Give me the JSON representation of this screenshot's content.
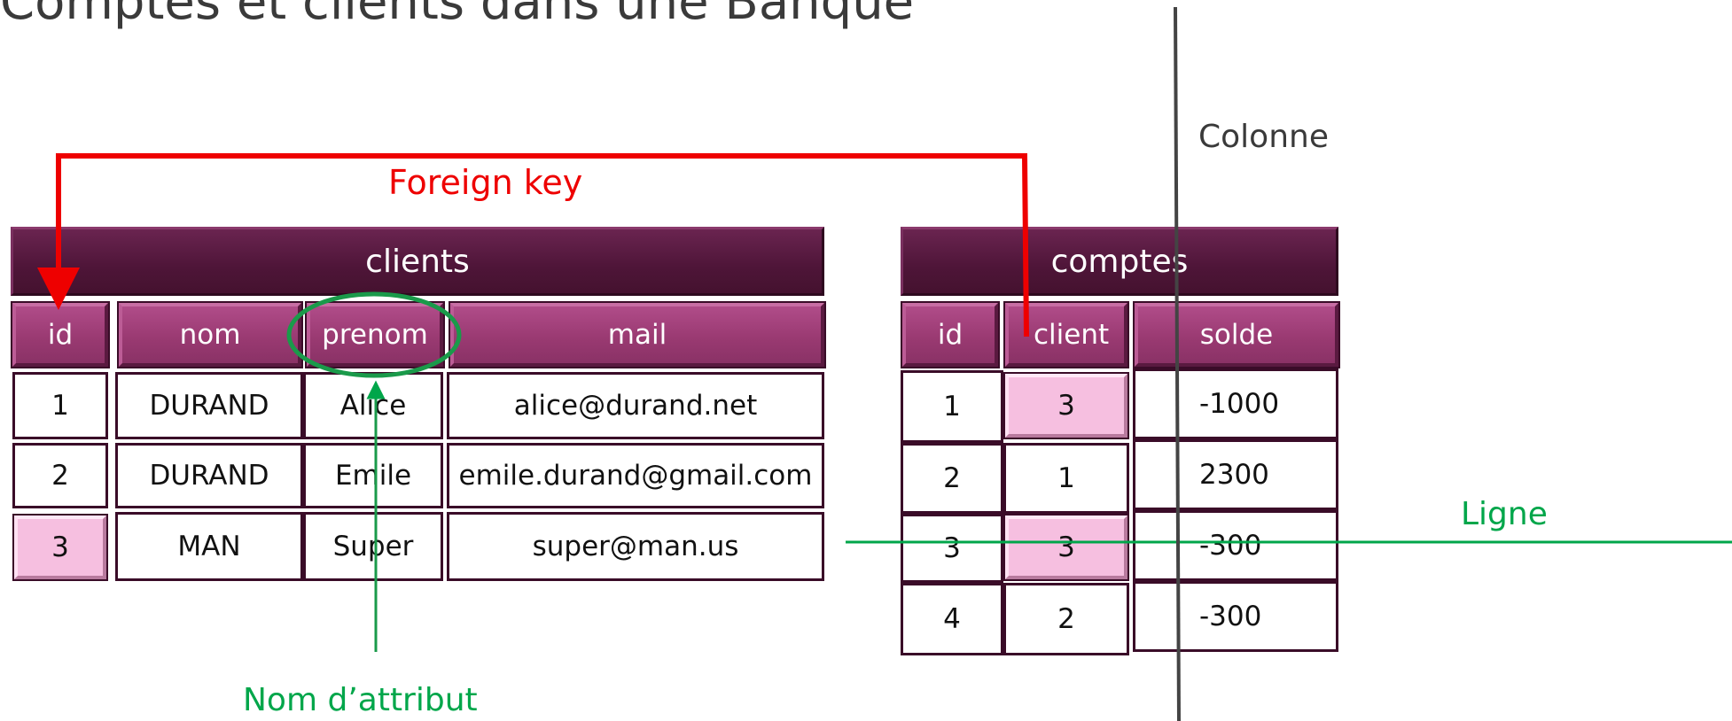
{
  "title": "Comptes et clients dans une Banque",
  "annotations": {
    "foreign_key": "Foreign key",
    "colonne": "Colonne",
    "ligne": "Ligne",
    "nom_attribut": "Nom d’attribut"
  },
  "clients": {
    "name": "clients",
    "columns": [
      "id",
      "nom",
      "prenom",
      "mail"
    ],
    "rows": [
      [
        "1",
        "DURAND",
        "Alice",
        "alice@durand.net"
      ],
      [
        "2",
        "DURAND",
        "Emile",
        "emile.durand@gmail.com"
      ],
      [
        "3",
        "MAN",
        "Super",
        "super@man.us"
      ]
    ]
  },
  "comptes": {
    "name": "comptes",
    "columns": [
      "id",
      "client",
      "solde"
    ],
    "rows": [
      [
        "1",
        "3",
        "-1000"
      ],
      [
        "2",
        "1",
        "2300"
      ],
      [
        "3",
        "3",
        "-300"
      ],
      [
        "4",
        "2",
        "-300"
      ]
    ]
  },
  "colors": {
    "title_bar": "#4e1538",
    "header": "#9a3a72",
    "highlight": "#f6bfe0",
    "foreign_key_arrow": "#ee0000",
    "annotation_green": "#00a64a"
  }
}
